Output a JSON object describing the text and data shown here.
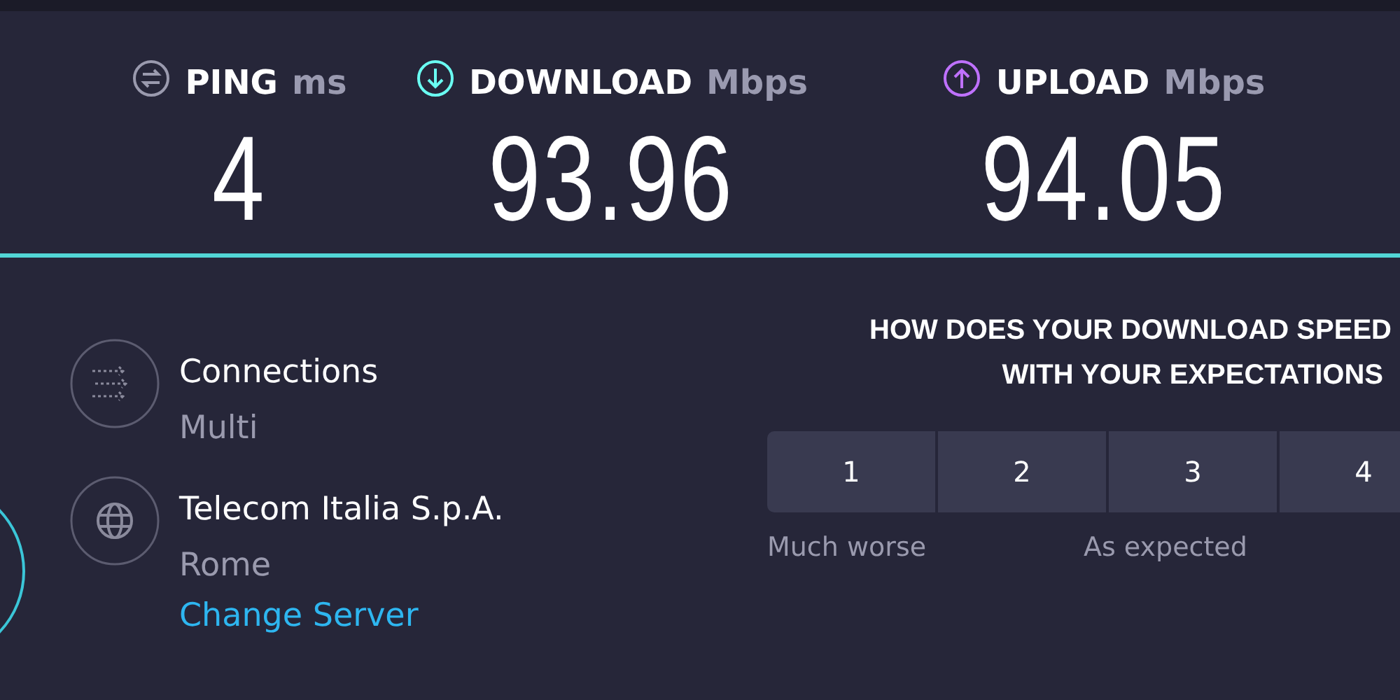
{
  "results": [
    {
      "kind": "ping",
      "label": "PING",
      "unit": "ms",
      "value": "4",
      "color": "#9a9aae"
    },
    {
      "kind": "download",
      "label": "DOWNLOAD",
      "unit": "Mbps",
      "value": "93.96",
      "color": "#6afff3"
    },
    {
      "kind": "upload",
      "label": "UPLOAD",
      "unit": "Mbps",
      "value": "94.05",
      "color": "#bf71ff"
    }
  ],
  "details": [
    {
      "kind": "connections",
      "title": "Connections",
      "subtitle": "Multi"
    },
    {
      "kind": "server",
      "title": "Telecom Italia S.p.A.",
      "subtitle": "Rome",
      "link": "Change Server"
    }
  ],
  "survey": {
    "question": [
      "HOW DOES YOUR DOWNLOAD SPEED",
      "WITH YOUR EXPECTATIONS"
    ],
    "options": [
      {
        "label": "1",
        "selected": false
      },
      {
        "label": "2",
        "selected": false
      },
      {
        "label": "3",
        "selected": false
      },
      {
        "label": "4",
        "selected": false
      }
    ],
    "scale_labels": [
      "Much worse",
      "As expected"
    ]
  }
}
